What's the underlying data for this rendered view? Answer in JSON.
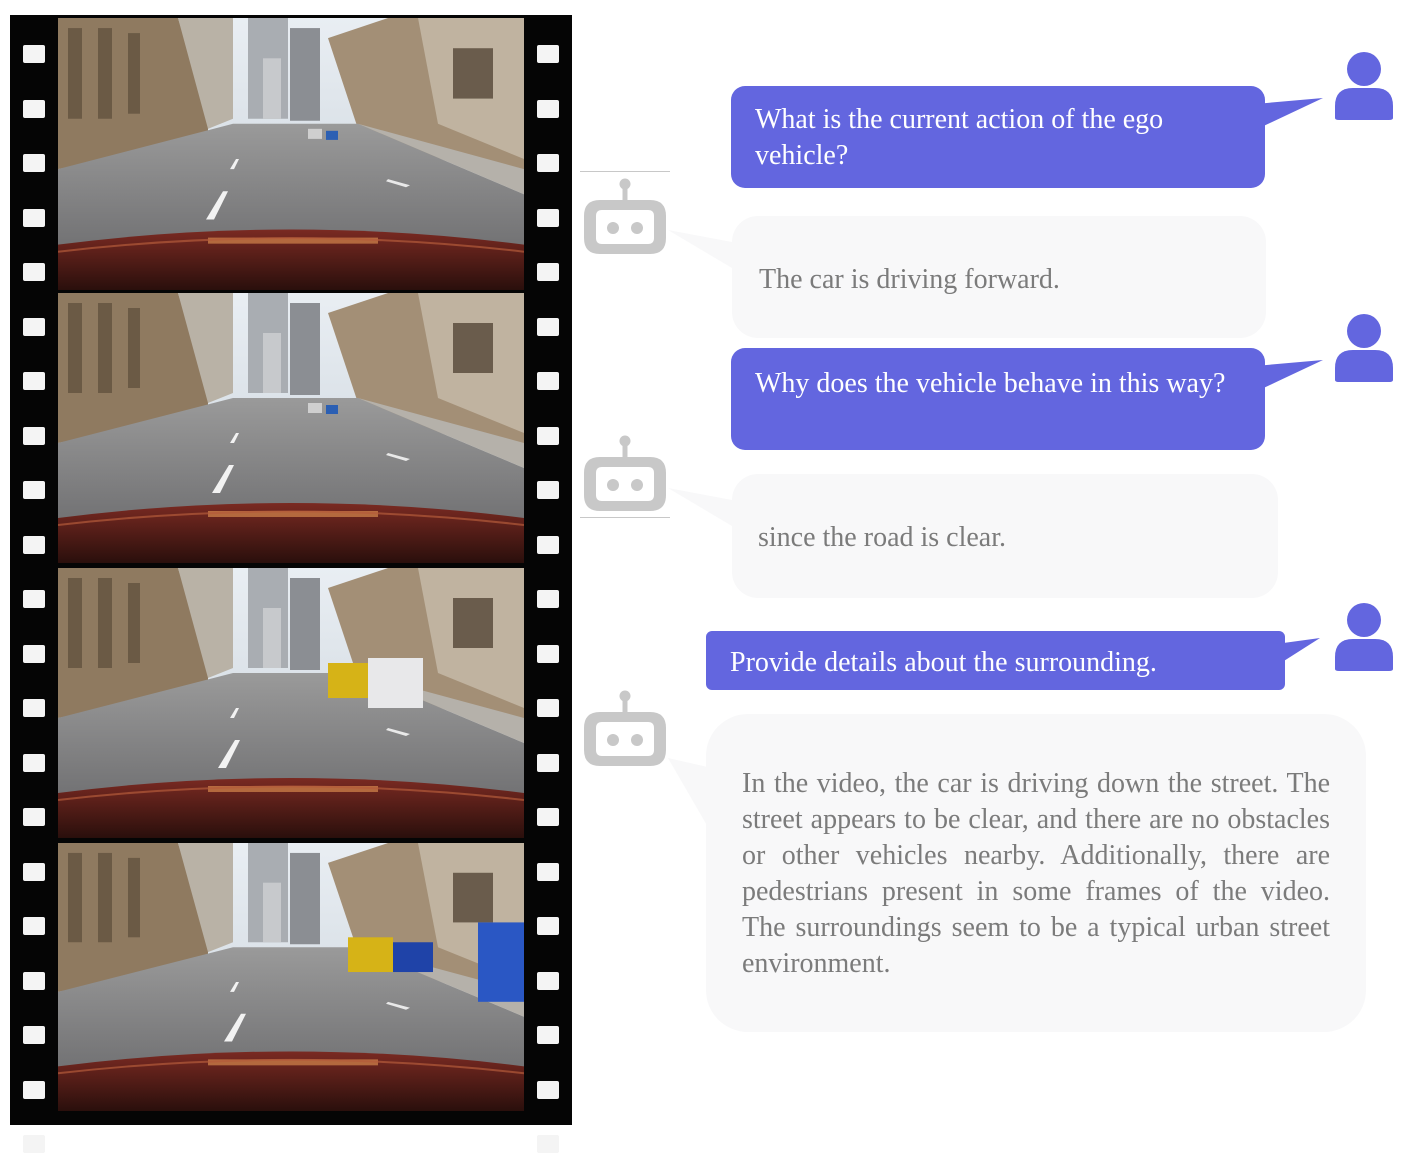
{
  "colors": {
    "question_bubble": "#6366df",
    "question_text": "#ffffff",
    "answer_bubble": "#f8f8f9",
    "answer_text": "#7b7b7b",
    "user_icon": "#6366df",
    "robot_icon": "#c8c8c8",
    "film": "#050505"
  },
  "icons": {
    "user": "user-icon",
    "assistant": "robot-icon"
  },
  "film_strip": {
    "frames": [
      {
        "scene": "dashcam-frame-1"
      },
      {
        "scene": "dashcam-frame-2"
      },
      {
        "scene": "dashcam-frame-3"
      },
      {
        "scene": "dashcam-frame-4"
      }
    ]
  },
  "conversation": [
    {
      "role": "user",
      "text": "What is the current action of the ego vehicle?"
    },
    {
      "role": "assistant",
      "text": "The car is driving forward."
    },
    {
      "role": "user",
      "text": "Why does the vehicle behave in  this way?"
    },
    {
      "role": "assistant",
      "text": "since the road is clear."
    },
    {
      "role": "user",
      "text": "Provide details about the surrounding."
    },
    {
      "role": "assistant",
      "text": "In the video, the car is driving down the street. The street appears to be clear, and there are no obstacles or other vehicles nearby. Additionally, there are pedestrians present in some frames of the video. The surroundings seem to be a typical urban street environment."
    }
  ]
}
